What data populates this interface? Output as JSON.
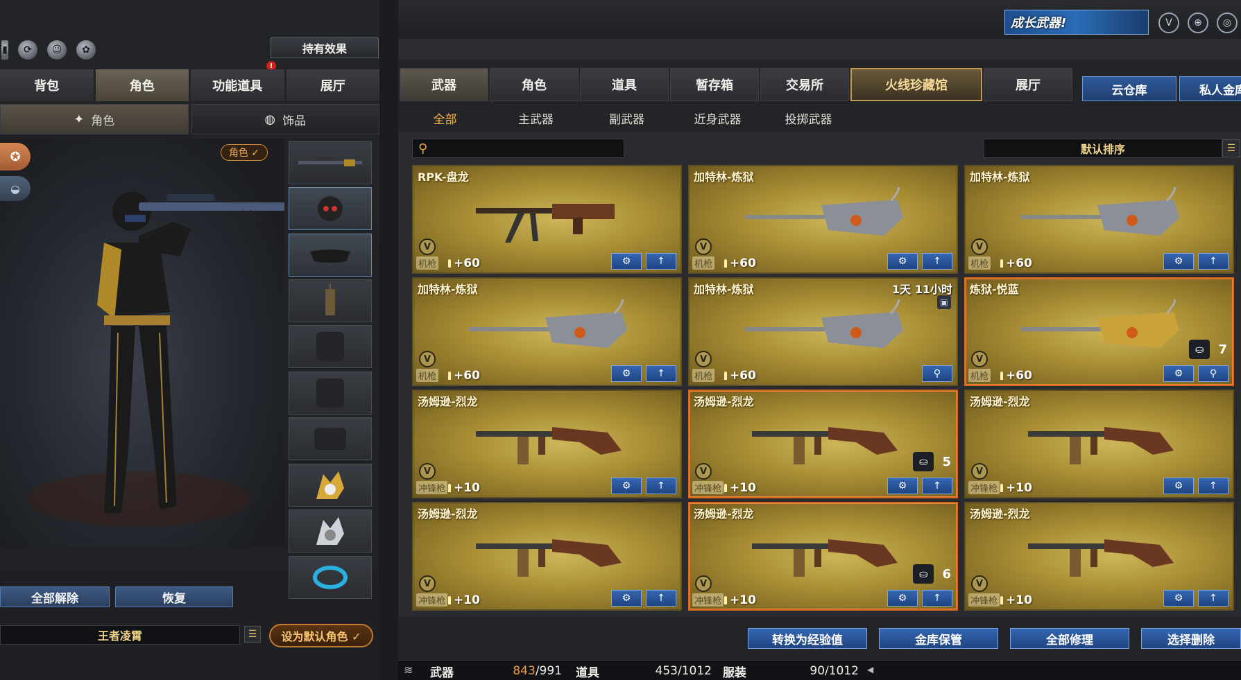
{
  "left_panel": {
    "effect_button": "持有效果",
    "alert_mark": "!",
    "tabs": [
      "背包",
      "角色",
      "功能道具",
      "展厅"
    ],
    "subtabs": [
      "角色",
      "饰品"
    ],
    "role_badge": "角色 ✓",
    "reset_buttons": [
      "全部解除",
      "恢复"
    ],
    "role_name": "王者凌霄",
    "default_role_button": "设为默认角色 ✓"
  },
  "right_panel": {
    "grow_banner": "成长武器!",
    "tabs": [
      "武器",
      "角色",
      "道具",
      "暂存箱",
      "交易所",
      "火线珍藏馆",
      "展厅"
    ],
    "cloud_button": "云仓库",
    "private_button": "私人金库",
    "categories": [
      "全部",
      "主武器",
      "副武器",
      "近身武器",
      "投掷武器"
    ],
    "search_placeholder": "",
    "sort_label": "默认排序",
    "cards": [
      {
        "name": "RPK-盘龙",
        "type": "机枪",
        "ammo": "+60"
      },
      {
        "name": "加特林-炼狱",
        "type": "机枪",
        "ammo": "+60"
      },
      {
        "name": "加特林-炼狱",
        "type": "机枪",
        "ammo": "+60"
      },
      {
        "name": "加特林-炼狱",
        "type": "机枪",
        "ammo": "+60"
      },
      {
        "name": "加特林-炼狱",
        "type": "机枪",
        "ammo": "+60",
        "time": "1天 11小时"
      },
      {
        "name": "炼狱-悦蓝",
        "type": "机枪",
        "ammo": "+60",
        "count": "7"
      },
      {
        "name": "汤姆逊-烈龙",
        "type": "冲锋枪",
        "ammo": "+10"
      },
      {
        "name": "汤姆逊-烈龙",
        "type": "冲锋枪",
        "ammo": "+10",
        "count": "5"
      },
      {
        "name": "汤姆逊-烈龙",
        "type": "冲锋枪",
        "ammo": "+10"
      },
      {
        "name": "汤姆逊-烈龙",
        "type": "冲锋枪",
        "ammo": "+10"
      },
      {
        "name": "汤姆逊-烈龙",
        "type": "冲锋枪",
        "ammo": "+10",
        "count": "6"
      },
      {
        "name": "汤姆逊-烈龙",
        "type": "冲锋枪",
        "ammo": "+10"
      }
    ],
    "bottom_buttons": [
      "转换为经验值",
      "金库保管",
      "全部修理",
      "选择删除"
    ],
    "status": {
      "weapon_label": "武器",
      "weapon_used": "843",
      "weapon_total": "/991",
      "item_label": "道具",
      "item_value": "453/1012",
      "costume_label": "服装",
      "costume_value": "90/1012"
    }
  },
  "colors": {
    "accent_orange": "#f2b84a",
    "button_blue": "#1f4481",
    "card_gold": "#a88d34",
    "highlight_border": "#d46822"
  }
}
